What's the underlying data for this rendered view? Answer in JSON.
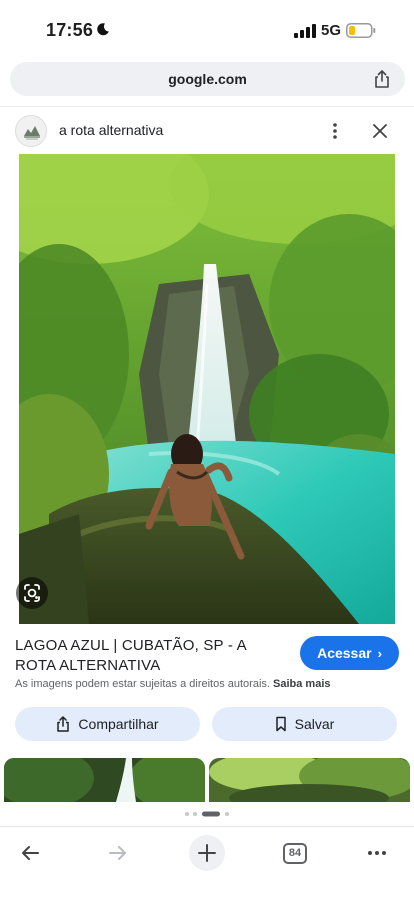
{
  "status_bar": {
    "time": "17:56",
    "network": "5G"
  },
  "address_bar": {
    "url": "google.com"
  },
  "site_header": {
    "name": "a rota alternativa"
  },
  "result": {
    "title": "LAGOA AZUL | CUBATÃO, SP - A ROTA ALTERNATIVA",
    "visit_label": "Acessar",
    "copyright_text": "As imagens podem estar sujeitas a direitos autorais.",
    "learn_more": "Saiba mais",
    "share_label": "Compartilhar",
    "save_label": "Salvar"
  },
  "toolbar": {
    "tab_count": "84"
  },
  "colors": {
    "accent": "#1a73e8",
    "action_bg": "#e3ecfb",
    "water": "#2fc9b8",
    "foliage": "#5c9a2c"
  }
}
